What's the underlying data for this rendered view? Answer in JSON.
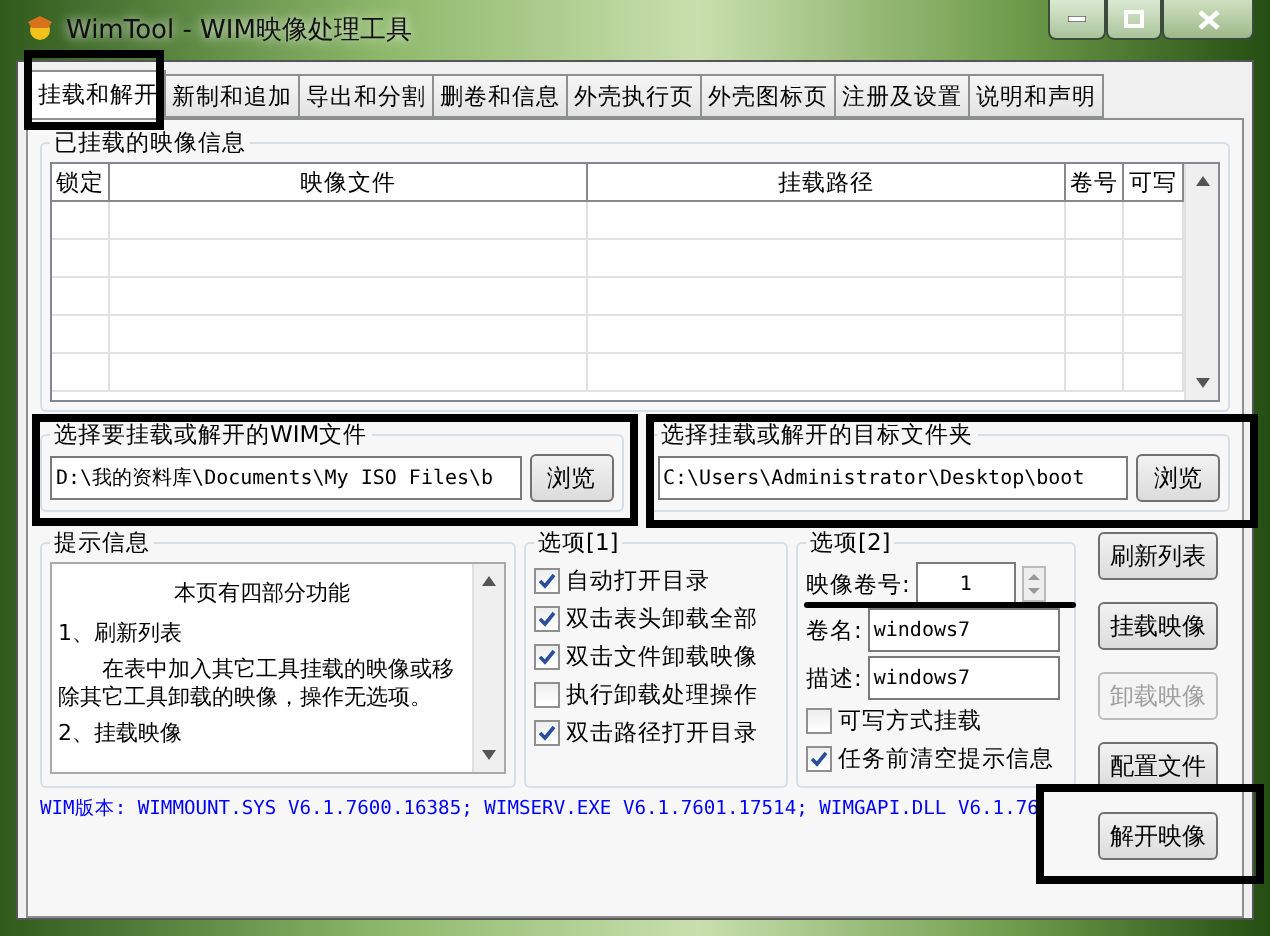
{
  "window": {
    "title": "WimTool - WIM映像处理工具"
  },
  "tabs": [
    {
      "label": "挂载和解开",
      "selected": true
    },
    {
      "label": "新制和追加",
      "selected": false
    },
    {
      "label": "导出和分割",
      "selected": false
    },
    {
      "label": "删卷和信息",
      "selected": false
    },
    {
      "label": "外壳执行页",
      "selected": false
    },
    {
      "label": "外壳图标页",
      "selected": false
    },
    {
      "label": "注册及设置",
      "selected": false
    },
    {
      "label": "说明和声明",
      "selected": false
    }
  ],
  "mounted": {
    "title": "已挂载的映像信息",
    "columns": [
      "锁定",
      "映像文件",
      "挂载路径",
      "卷号",
      "可写"
    ]
  },
  "file_groups": [
    {
      "title": "选择要挂载或解开的WIM文件",
      "value": "D:\\我的资料库\\Documents\\My ISO Files\\b",
      "button": "浏览"
    },
    {
      "title": "选择挂载或解开的目标文件夹",
      "value": "C:\\Users\\Administrator\\Desktop\\boot",
      "button": "浏览"
    }
  ],
  "info": {
    "title": "提示信息",
    "heading": "本页有四部分功能",
    "lines": [
      "1、刷新列表",
      "　　在表中加入其它工具挂载的映像或移除其它工具卸载的映像，操作无选项。",
      "2、挂载映像"
    ]
  },
  "options1": {
    "title": "选项[1]",
    "items": [
      {
        "label": "自动打开目录",
        "checked": true
      },
      {
        "label": "双击表头卸载全部",
        "checked": true
      },
      {
        "label": "双击文件卸载映像",
        "checked": true
      },
      {
        "label": "执行卸载处理操作",
        "checked": false
      },
      {
        "label": "双击路径打开目录",
        "checked": true
      }
    ]
  },
  "options2": {
    "title": "选项[2]",
    "volume_label": "映像卷号:",
    "volume_value": "1",
    "fields": [
      {
        "label": "卷名:",
        "value": "windows7"
      },
      {
        "label": "描述:",
        "value": "windows7"
      }
    ],
    "items": [
      {
        "label": "可写方式挂载",
        "checked": false
      },
      {
        "label": "任务前清空提示信息",
        "checked": true
      }
    ]
  },
  "buttons": [
    {
      "label": "刷新列表",
      "disabled": false
    },
    {
      "label": "挂载映像",
      "disabled": false
    },
    {
      "label": "卸载映像",
      "disabled": true
    },
    {
      "label": "配置文件",
      "disabled": false
    },
    {
      "label": "解开映像",
      "disabled": false
    }
  ],
  "version": "WIM版本: WIMMOUNT.SYS V6.1.7600.16385; WIMSERV.EXE V6.1.7601.17514; WIMGAPI.DLL V6.1.76"
}
